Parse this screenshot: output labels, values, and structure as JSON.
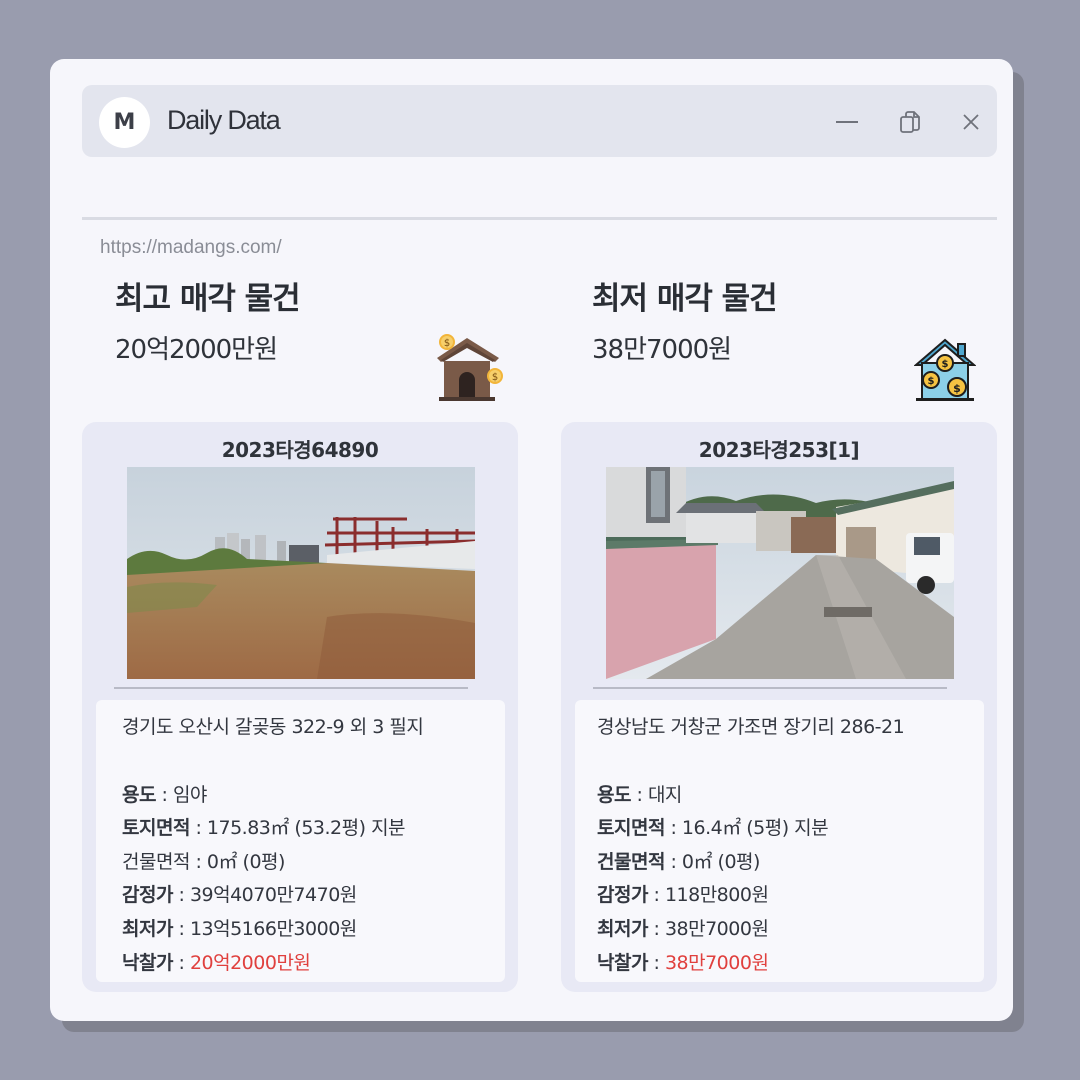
{
  "window": {
    "logo_letter": "M",
    "title": "Daily Data",
    "url": "https://madangs.com/"
  },
  "highest": {
    "heading": "최고 매각 물건",
    "price": "20억2000만원",
    "icon": "house-money-icon",
    "card": {
      "case_no": "2023타경64890",
      "address": "경기도 오산시 갈곶동 322-9 외 3 필지",
      "use_label": "용도",
      "use_value": "임야",
      "land_label": "토지면적",
      "land_value": "175.83㎡ (53.2평) 지분",
      "building_label": "건물면적",
      "building_value": "0㎡ (0평)",
      "appraisal_label": "감정가",
      "appraisal_value": "39억4070만7470원",
      "min_label": "최저가",
      "min_value": "13억5166만3000원",
      "winning_label": "낙찰가",
      "winning_value": "20억2000만원"
    }
  },
  "lowest": {
    "heading": "최저 매각 물건",
    "price": "38만7000원",
    "icon": "house-coins-icon",
    "card": {
      "case_no": "2023타경253[1]",
      "address": "경상남도 거창군 가조면 장기리 286-21",
      "use_label": "용도",
      "use_value": "대지",
      "land_label": "토지면적",
      "land_value": "16.4㎡ (5평) 지분",
      "building_label": "건물면적",
      "building_value": "0㎡ (0평)",
      "appraisal_label": "감정가",
      "appraisal_value": "118만800원",
      "min_label": "최저가",
      "min_value": "38만7000원",
      "winning_label": "낙찰가",
      "winning_value": "38만7000원"
    }
  },
  "colors": {
    "accent_red": "#e0403e",
    "card_bg": "#e8e9f5",
    "page_bg": "#999cae"
  }
}
